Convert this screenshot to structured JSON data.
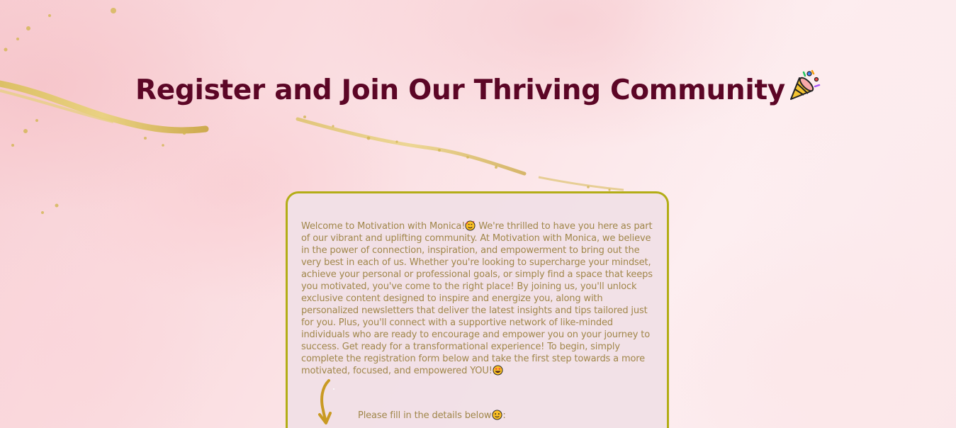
{
  "page": {
    "title": "Register and Join Our Thriving Community",
    "title_icon": "party-popper-icon",
    "colors": {
      "title": "#5c0626",
      "card_border": "#b3ad16",
      "card_background": "#f1e0e6",
      "body_text": "#a0864a",
      "gold_accent": "#c9a640"
    }
  },
  "card": {
    "intro_text_1": "Welcome to Motivation with Monica!",
    "intro_icon_1": "smiling-face-with-hearts-icon",
    "intro_text_2": " We're thrilled to have you here as part of our vibrant and uplifting community. At Motivation with Monica, we believe in the power of connection, inspiration, and empowerment to bring out the very best in each of us. Whether you're looking to supercharge your mindset, achieve your personal or professional goals, or simply find a space that keeps you motivated, you've come to the right place! By joining us, you'll unlock exclusive content designed to inspire and energize you, along with personalized newsletters that deliver the latest insights and tips tailored just for you. Plus, you'll connect with a supportive network of like-minded individuals who are ready to encourage and empower you on your journey to success. Get ready for a transformational experience! To begin, simply complete the registration form below and take the first step towards a more motivated, focused, and empowered YOU!",
    "intro_icon_2": "heart-eyes-icon",
    "arrow_icon": "down-arrow-icon",
    "fill_note": "Please fill in the details below",
    "fill_note_icon": "slightly-smiling-face-icon",
    "fill_note_suffix": ":"
  }
}
